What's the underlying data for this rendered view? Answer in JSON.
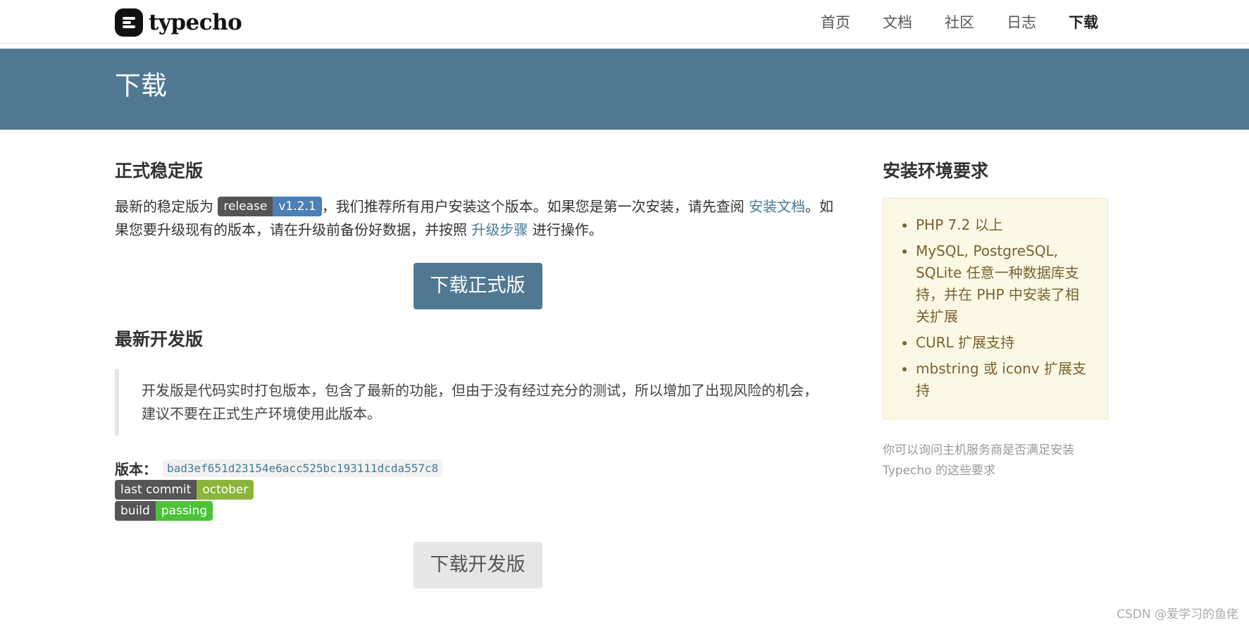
{
  "header": {
    "logo_text": "typecho",
    "nav": [
      {
        "label": "首页"
      },
      {
        "label": "文档"
      },
      {
        "label": "社区"
      },
      {
        "label": "日志"
      },
      {
        "label": "下载"
      }
    ],
    "active_nav": "下载"
  },
  "banner": {
    "title": "下载"
  },
  "stable": {
    "heading": "正式稳定版",
    "intro_1": "最新的稳定版为",
    "badge_left": "release",
    "badge_right": "v1.2.1",
    "intro_2": "，我们推荐所有用户安装这个版本。如果您是第一次安装，请先查阅",
    "install_doc_link": "安装文档",
    "intro_3": "。如果您要升级现有的版本，请在升级前备份好数据，并按照",
    "upgrade_link": "升级步骤",
    "intro_4": "进行操作。",
    "download_button": "下载正式版"
  },
  "dev": {
    "heading": "最新开发版",
    "quote": "开发版是代码实时打包版本，包含了最新的功能，但由于没有经过充分的测试，所以增加了出现风险的机会，建议不要在正式生产环境使用此版本。",
    "version_label": "版本：",
    "version_hash": "bad3ef651d23154e6acc525bc193111dcda557c8",
    "commit_badge_left": "last commit",
    "commit_badge_right": "october",
    "build_badge_left": "build",
    "build_badge_right": "passing",
    "download_button": "下载开发版"
  },
  "sidebar": {
    "heading": "安装环境要求",
    "requirements": [
      "PHP 7.2 以上",
      "MySQL, PostgreSQL, SQLite 任意一种数据库支持，并在 PHP 中安装了相关扩展",
      "CURL 扩展支持",
      "mbstring 或 iconv 扩展支持"
    ],
    "note": "你可以询问主机服务商是否满足安装 Typecho 的这些要求"
  },
  "watermark": "CSDN @爱学习的鱼佬",
  "colors": {
    "banner": "#517893",
    "link": "#467b96",
    "req_bg": "#fbf8e5",
    "req_text": "#7a6232"
  }
}
